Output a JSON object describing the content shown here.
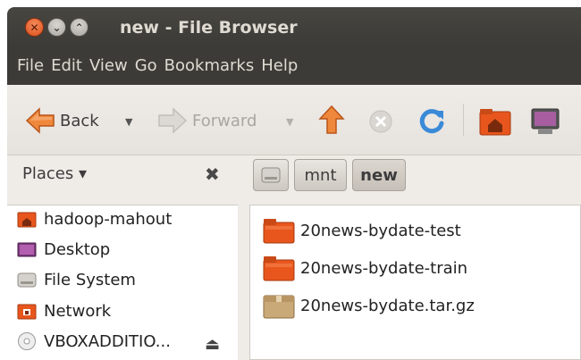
{
  "window": {
    "title": "new - File Browser"
  },
  "window_buttons": {
    "close": "✕",
    "minimize": "⌄",
    "maximize": "⌃"
  },
  "menubar": {
    "items": [
      "File",
      "Edit",
      "View",
      "Go",
      "Bookmarks",
      "Help"
    ]
  },
  "toolbar": {
    "back_label": "Back",
    "forward_label": "Forward",
    "dropdown_glyph": "▼"
  },
  "sidebar": {
    "header": "Places ▾",
    "close_glyph": "✖",
    "items": [
      {
        "label": "hadoop-mahout",
        "icon": "home-folder-icon"
      },
      {
        "label": "Desktop",
        "icon": "desktop-icon"
      },
      {
        "label": "File System",
        "icon": "drive-icon"
      },
      {
        "label": "Network",
        "icon": "network-icon"
      },
      {
        "label": "VBOXADDITIO...",
        "icon": "cdrom-icon"
      }
    ],
    "eject_glyph": "⏏"
  },
  "path_bar": {
    "crumbs": [
      "mnt",
      "new"
    ]
  },
  "files": [
    {
      "name": "20news-bydate-test",
      "type": "folder"
    },
    {
      "name": "20news-bydate-train",
      "type": "folder"
    },
    {
      "name": "20news-bydate.tar.gz",
      "type": "archive"
    }
  ],
  "colors": {
    "titlebar": "#3c3b37",
    "accent_orange": "#e8561d",
    "window_bg": "#efebe7"
  }
}
